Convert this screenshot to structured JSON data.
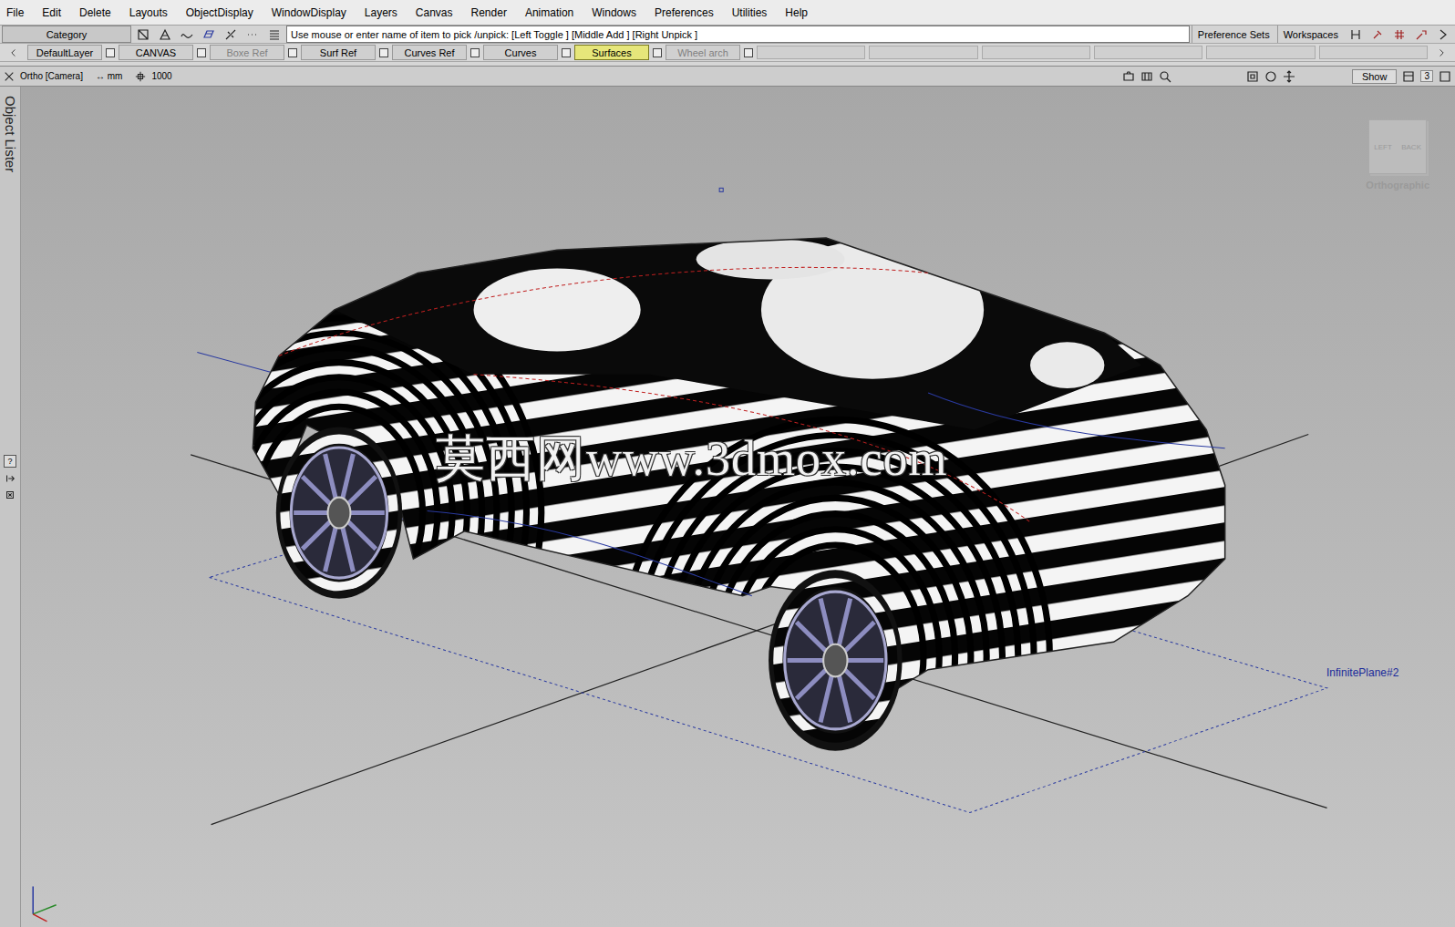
{
  "menu": [
    "File",
    "Edit",
    "Delete",
    "Layouts",
    "ObjectDisplay",
    "WindowDisplay",
    "Layers",
    "Canvas",
    "Render",
    "Animation",
    "Windows",
    "Preferences",
    "Utilities",
    "Help"
  ],
  "toolbar": {
    "category": "Category",
    "prompt": "Use mouse or enter name of item to pick /unpick: [Left Toggle ] [Middle Add ] [Right Unpick ]",
    "buttons": [
      "Preference Sets",
      "Workspaces"
    ]
  },
  "layers": [
    {
      "label": "DefaultLayer",
      "selected": false,
      "disabled": false
    },
    {
      "label": "CANVAS",
      "selected": false,
      "disabled": false
    },
    {
      "label": "Boxe Ref",
      "selected": false,
      "disabled": true
    },
    {
      "label": "Surf Ref",
      "selected": false,
      "disabled": false
    },
    {
      "label": "Curves Ref",
      "selected": false,
      "disabled": false
    },
    {
      "label": "Curves",
      "selected": false,
      "disabled": false
    },
    {
      "label": "Surfaces",
      "selected": true,
      "disabled": false
    },
    {
      "label": "Wheel arch",
      "selected": false,
      "disabled": true
    }
  ],
  "viewport": {
    "camera": "Ortho [Camera]",
    "units_arrow": "↔",
    "units": "mm",
    "grid": "1000",
    "show": "Show",
    "count": "3",
    "side_tab": "Object Lister",
    "help": "?",
    "view_cube": {
      "faces": [
        "LEFT",
        "BACK"
      ],
      "label": "Orthographic"
    },
    "plane_label": "InfinitePlane#2",
    "watermark": "莫西网www.3dmox.com"
  }
}
